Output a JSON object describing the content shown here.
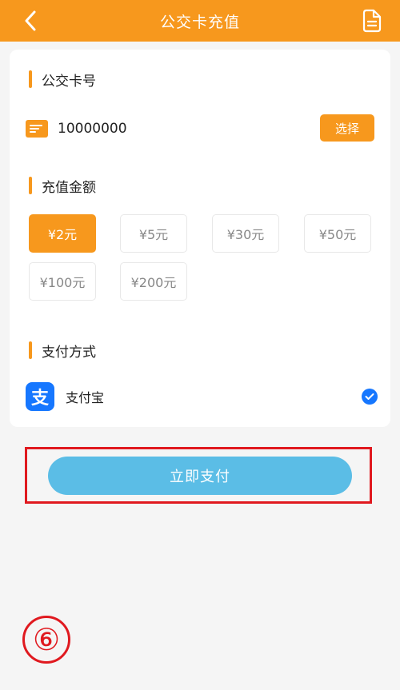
{
  "header": {
    "title": "公交卡充值",
    "back_icon": "chevron-left-icon",
    "record_icon": "document-icon"
  },
  "card_section": {
    "title": "公交卡号",
    "card_number": "10000000",
    "select_label": "选择",
    "icon": "card-icon"
  },
  "amount_section": {
    "title": "充值金额",
    "options": [
      "¥2元",
      "¥5元",
      "¥30元",
      "¥50元",
      "¥100元",
      "¥200元"
    ],
    "selected": "¥2元"
  },
  "payment_section": {
    "title": "支付方式",
    "method": "支付宝",
    "logo_char": "支",
    "checked": true
  },
  "pay_button": {
    "label": "立即支付"
  },
  "annotation": {
    "step": "⑥"
  },
  "colors": {
    "accent": "#f7981d",
    "alipay": "#1677ff",
    "pay_button": "#5bbde6",
    "highlight": "#e0191f"
  }
}
